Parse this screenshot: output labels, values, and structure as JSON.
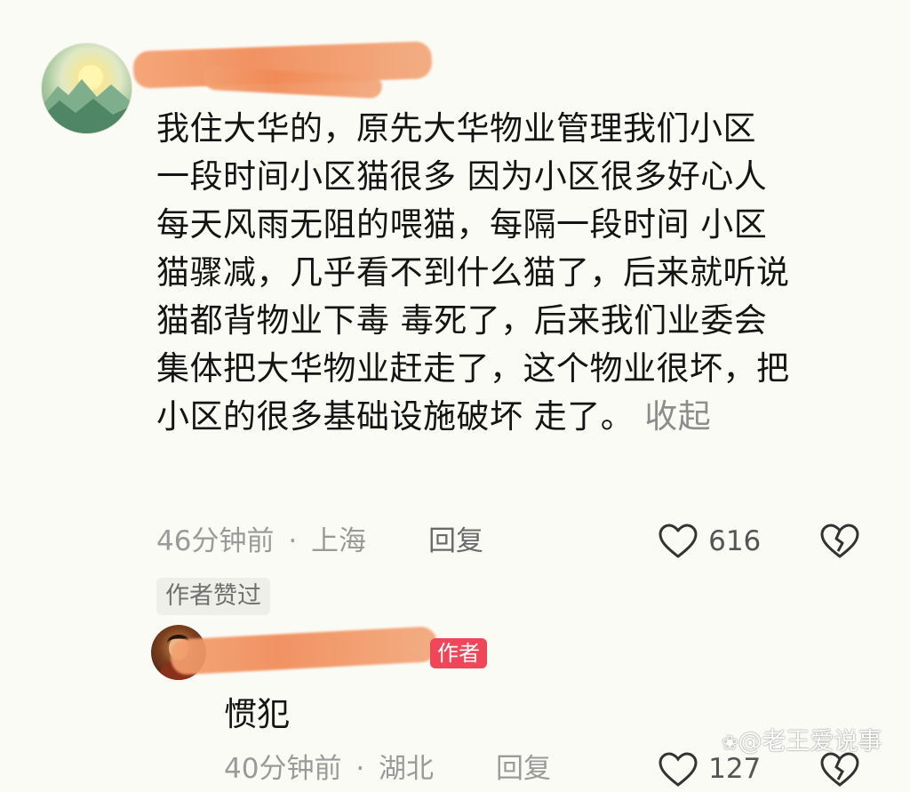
{
  "comment": {
    "lines": [
      "我住大华的，原先大华物业管理我们小区",
      "一段时间小区猫很多 因为小区很多好心人",
      "每天风雨无阻的喂猫，每隔一段时间 小区",
      "猫骤减，几乎看不到什么猫了，后来就听说",
      "猫都背物业下毒 毒死了，后来我们业委会",
      "集体把大华物业赶走了，这个物业很坏，把",
      "小区的很多基础设施破坏 走了。"
    ],
    "collapse_label": "收起",
    "time": "46分钟前",
    "separator": "·",
    "location": "上海",
    "reply_label": "回复",
    "like_count": "616",
    "author_liked_badge": "作者赞过"
  },
  "reply": {
    "author_tag": "作者",
    "text": "惯犯",
    "time": "40分钟前",
    "separator": "·",
    "location": "湖北",
    "reply_label": "回复",
    "like_count": "127"
  },
  "watermark": "老王爱说事",
  "colors": {
    "background": "#fbfbf6",
    "text": "#141414",
    "muted": "#9a9a9a",
    "redaction": "#f18a56",
    "author_tag": "#f0465a"
  },
  "icons": [
    "heart-icon",
    "broken-heart-icon",
    "watermark-logo-icon"
  ]
}
